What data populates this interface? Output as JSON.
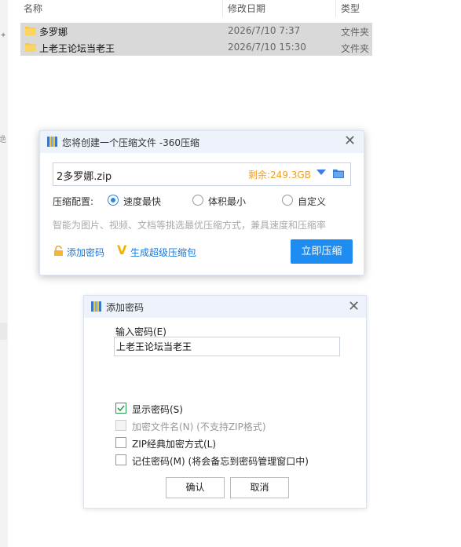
{
  "explorer": {
    "columns": {
      "name": "名称",
      "date": "修改日期",
      "type": "类型"
    },
    "files": [
      {
        "name": "多罗娜",
        "date": "2026/7/10 7:37",
        "type": "文件夹"
      },
      {
        "name": "上老王论坛当老王",
        "date": "2026/7/10 15:30",
        "type": "文件夹"
      }
    ],
    "left_glyph": "绝"
  },
  "compress_dialog": {
    "title": "您将创建一个压缩文件 -360压缩",
    "filename": "2多罗娜.zip",
    "remaining": "剩余:249.3GB",
    "config_label": "压缩配置:",
    "options": [
      {
        "label": "速度最快",
        "checked": true
      },
      {
        "label": "体积最小",
        "checked": false
      },
      {
        "label": "自定义",
        "checked": false
      }
    ],
    "hint": "智能为图片、视频、文档等挑选最优压缩方式，兼具速度和压缩率",
    "add_password": "添加密码",
    "super_compress": "生成超级压缩包",
    "start_button": "立即压缩",
    "colors": {
      "accent": "#1e8cf0",
      "remaining": "#f0a020"
    }
  },
  "password_dialog": {
    "title": "添加密码",
    "input_label": "输入密码(E)",
    "password_value": "上老王论坛当老王",
    "checkboxes": [
      {
        "label": "显示密码(S)",
        "checked": true,
        "disabled": false
      },
      {
        "label": "加密文件名(N) (不支持ZIP格式)",
        "checked": false,
        "disabled": true
      },
      {
        "label": "ZIP经典加密方式(L)",
        "checked": false,
        "disabled": false
      },
      {
        "label": "记住密码(M) (将会备忘到密码管理窗口中)",
        "checked": false,
        "disabled": false
      }
    ],
    "ok": "确认",
    "cancel": "取消"
  }
}
